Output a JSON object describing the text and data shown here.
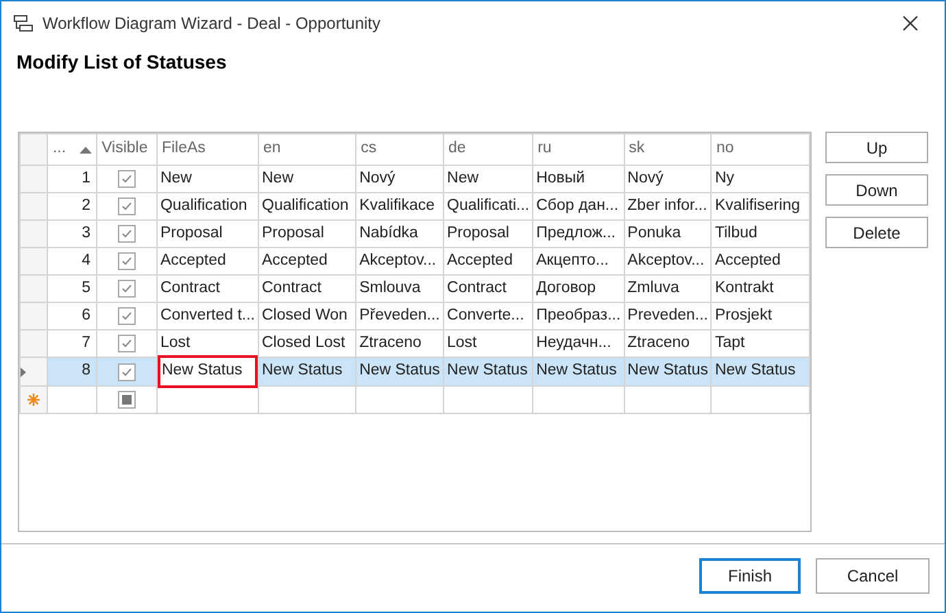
{
  "window": {
    "title": "Workflow Diagram Wizard - Deal - Opportunity"
  },
  "heading": "Modify List of Statuses",
  "grid": {
    "number_column": {
      "label": "...",
      "sorted_ascending": true
    },
    "visible_column": {
      "label": "Visible"
    },
    "columns": [
      "FileAs",
      "en",
      "cs",
      "de",
      "ru",
      "sk",
      "no"
    ],
    "rows": [
      {
        "number": "1",
        "visible": true,
        "selected": false,
        "outlined_first_cell": false,
        "cells": [
          "New",
          "New",
          "Nový",
          "New",
          "Новый",
          "Nový",
          "Ny"
        ]
      },
      {
        "number": "2",
        "visible": true,
        "selected": false,
        "outlined_first_cell": false,
        "cells": [
          "Qualification",
          "Qualification",
          "Kvalifikace",
          "Qualificati...",
          "Сбор дан...",
          "Zber infor...",
          "Kvalifisering"
        ]
      },
      {
        "number": "3",
        "visible": true,
        "selected": false,
        "outlined_first_cell": false,
        "cells": [
          "Proposal",
          "Proposal",
          "Nabídka",
          "Proposal",
          "Предлож...",
          "Ponuka",
          "Tilbud"
        ]
      },
      {
        "number": "4",
        "visible": true,
        "selected": false,
        "outlined_first_cell": false,
        "cells": [
          "Accepted",
          "Accepted",
          "Akceptov...",
          "Accepted",
          "Акцепто...",
          "Akceptov...",
          "Accepted"
        ]
      },
      {
        "number": "5",
        "visible": true,
        "selected": false,
        "outlined_first_cell": false,
        "cells": [
          "Contract",
          "Contract",
          "Smlouva",
          "Contract",
          "Договор",
          "Zmluva",
          "Kontrakt"
        ]
      },
      {
        "number": "6",
        "visible": true,
        "selected": false,
        "outlined_first_cell": false,
        "cells": [
          "Converted t...",
          "Closed Won",
          "Převeden...",
          "Converte...",
          "Преобраз...",
          "Preveden...",
          "Prosjekt"
        ]
      },
      {
        "number": "7",
        "visible": true,
        "selected": false,
        "outlined_first_cell": false,
        "cells": [
          "Lost",
          "Closed Lost",
          "Ztraceno",
          "Lost",
          "Неудачн...",
          "Ztraceno",
          "Tapt"
        ]
      },
      {
        "number": "8",
        "visible": true,
        "selected": true,
        "outlined_first_cell": true,
        "cells": [
          "New Status",
          "New Status",
          "New Status",
          "New Status",
          "New Status",
          "New Status",
          "New Status"
        ]
      }
    ],
    "new_row": {
      "visible_indeterminate": true
    }
  },
  "side_buttons": [
    "Up",
    "Down",
    "Delete"
  ],
  "footer_buttons": [
    {
      "label": "Finish",
      "default": true
    },
    {
      "label": "Cancel",
      "default": false
    }
  ]
}
